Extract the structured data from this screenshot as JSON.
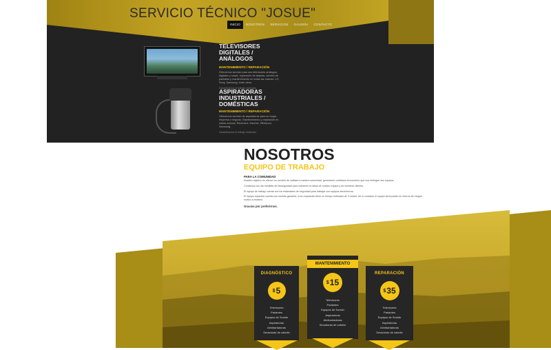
{
  "site": {
    "title": "SERVICIO TÉCNICO \"JOSUE\""
  },
  "nav": [
    "INICIO",
    "NOSOTROS",
    "SERVICIOS",
    "GALERÍA",
    "CONTACTO"
  ],
  "services": [
    {
      "title": "TELEVISORES DIGITALES / ANÁLOGOS",
      "subtitle": "MANTENIMIENTO / REPARACIÓN",
      "text": "Ofrecemos servicio para sus televisores análogos, digitales y smart, reparación de tarjetas, cambio de pantallas y mantenimiento en todas las marcas: LG, Sony, Samsung, entre otras.",
      "footer": "Garantizamos el trabajo realizado."
    },
    {
      "title": "ASPIRADORAS INDUSTRIALES / DOMÉSTICAS",
      "subtitle": "MANTENIMIENTO / REPARACIÓN",
      "text": "Ofrecemos servicio de aspiradoras para su hogar, empresa o negocio. Mantenimiento y reparación en varias marcas: Electrolux, Karcher, Whirlpool, Samsung.",
      "footer": "Garantizamos el trabajo realizado."
    }
  ],
  "about": {
    "title": "NOSOTROS",
    "subtitle": "EQUIPO DE TRABAJO",
    "heading": "PARA LA COMUNIDAD",
    "paragraphs": [
      "Nuestro objetivo es ofrecer un servicio de calidad a nuestra comunidad, generando confianza al momento que nos entregan sus equipos.",
      "Contamos con las medidas de bioseguridad para mantener la salud de nuestro equipo y de nuestros clientes.",
      "El equipo de trabajo cuenta con los estándares de seguridad para trabajar con equipos electrónicos.",
      "El equipo reparado cuenta con nuestra garantía, si su reparación tiene un tiempo estimado de 3 meses, de lo contrario el equipo será puesto en retorno sin ningún motivo a reclamo."
    ],
    "thanks": "Gracias por preferirnos."
  },
  "plans": [
    {
      "name": "DIAGNÓSTICO",
      "currency": "$",
      "amount": "5",
      "features": [
        "Televisores",
        "Parlantes",
        "Equipos de Sonido",
        "Aspiradoras",
        "Almibartadoras",
        "Secadoras de cabello"
      ]
    },
    {
      "name": "MANTENIMIENTO",
      "currency": "$",
      "amount": "15",
      "features": [
        "Televisores",
        "Parlantes",
        "Equipos de Sonido",
        "Aspiradoras",
        "Almibartadoras",
        "Secadoras de cabello"
      ]
    },
    {
      "name": "REPARACIÓN",
      "currency": "$",
      "amount": "35",
      "features": [
        "Televisores",
        "Parlantes",
        "Equipos de Sonido",
        "Aspiradoras",
        "Almibartadoras",
        "Secadoras de cabello"
      ]
    }
  ],
  "colors": {
    "accent": "#f5c518",
    "dark": "#222222",
    "olive": "#b89a1c"
  }
}
